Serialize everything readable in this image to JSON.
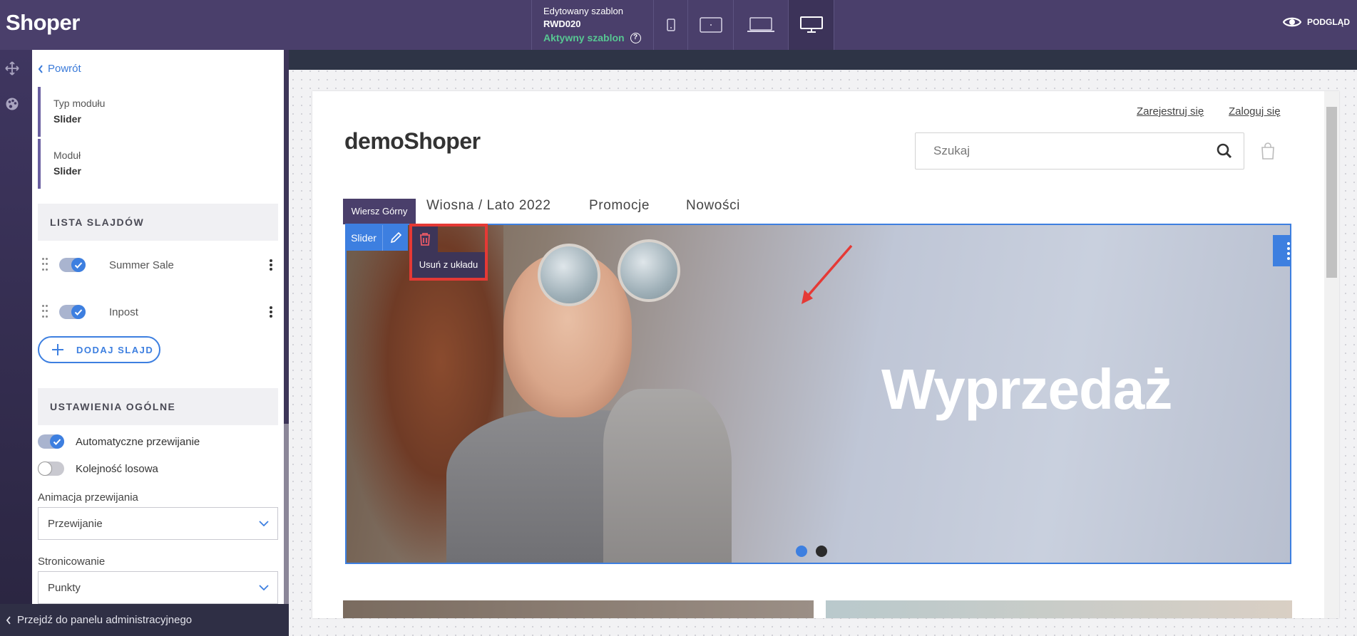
{
  "app": {
    "logo": "Shoper",
    "template_label": "Edytowany szablon",
    "template_code": "RWD020",
    "template_status": "Aktywny szablon",
    "preview_label": "PODGLĄD"
  },
  "panel": {
    "back_label": "Powrót",
    "module_type_key": "Typ modułu",
    "module_type_value": "Slider",
    "module_key": "Moduł",
    "module_value": "Slider",
    "slides_section": "LISTA SLAJDÓW",
    "slides": [
      {
        "name": "Summer Sale",
        "enabled": true
      },
      {
        "name": "Inpost",
        "enabled": true
      }
    ],
    "add_slide_label": "DODAJ SLAJD",
    "general_section": "USTAWIENIA OGÓLNE",
    "autoplay_label": "Automatyczne przewijanie",
    "autoplay_on": true,
    "random_label": "Kolejność losowa",
    "random_on": false,
    "animation_label": "Animacja przewijania",
    "animation_value": "Przewijanie",
    "pagination_label": "Stronicowanie",
    "pagination_value": "Punkty",
    "admin_link": "Przejdź do panelu administracyjnego"
  },
  "shop": {
    "register_link": "Zarejestruj się",
    "login_link": "Zaloguj się",
    "brand": "demoShoper",
    "search_placeholder": "Szukaj",
    "nav": [
      "Wiosna / Lato 2022",
      "Promocje",
      "Nowości"
    ],
    "row_tag": "Wiersz Górny",
    "slider_tag": "Slider",
    "delete_tooltip": "Usuń z układu",
    "slide_headline": "Wyprzedaż",
    "active_dot": 0,
    "dot_count": 2
  },
  "colors": {
    "topbar": "#4a3f6b",
    "accent_blue": "#3d7fe0",
    "status_green": "#57c792",
    "highlight_red": "#e53935"
  }
}
